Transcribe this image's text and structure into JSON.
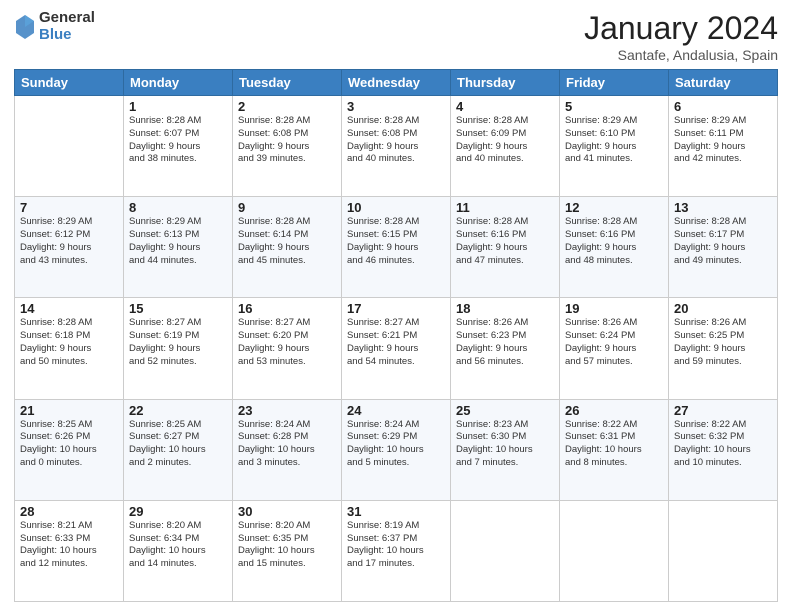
{
  "header": {
    "logo_general": "General",
    "logo_blue": "Blue",
    "month_title": "January 2024",
    "location": "Santafe, Andalusia, Spain"
  },
  "calendar": {
    "days_of_week": [
      "Sunday",
      "Monday",
      "Tuesday",
      "Wednesday",
      "Thursday",
      "Friday",
      "Saturday"
    ],
    "weeks": [
      [
        {
          "day": "",
          "info": ""
        },
        {
          "day": "1",
          "info": "Sunrise: 8:28 AM\nSunset: 6:07 PM\nDaylight: 9 hours\nand 38 minutes."
        },
        {
          "day": "2",
          "info": "Sunrise: 8:28 AM\nSunset: 6:08 PM\nDaylight: 9 hours\nand 39 minutes."
        },
        {
          "day": "3",
          "info": "Sunrise: 8:28 AM\nSunset: 6:08 PM\nDaylight: 9 hours\nand 40 minutes."
        },
        {
          "day": "4",
          "info": "Sunrise: 8:28 AM\nSunset: 6:09 PM\nDaylight: 9 hours\nand 40 minutes."
        },
        {
          "day": "5",
          "info": "Sunrise: 8:29 AM\nSunset: 6:10 PM\nDaylight: 9 hours\nand 41 minutes."
        },
        {
          "day": "6",
          "info": "Sunrise: 8:29 AM\nSunset: 6:11 PM\nDaylight: 9 hours\nand 42 minutes."
        }
      ],
      [
        {
          "day": "7",
          "info": "Sunrise: 8:29 AM\nSunset: 6:12 PM\nDaylight: 9 hours\nand 43 minutes."
        },
        {
          "day": "8",
          "info": "Sunrise: 8:29 AM\nSunset: 6:13 PM\nDaylight: 9 hours\nand 44 minutes."
        },
        {
          "day": "9",
          "info": "Sunrise: 8:28 AM\nSunset: 6:14 PM\nDaylight: 9 hours\nand 45 minutes."
        },
        {
          "day": "10",
          "info": "Sunrise: 8:28 AM\nSunset: 6:15 PM\nDaylight: 9 hours\nand 46 minutes."
        },
        {
          "day": "11",
          "info": "Sunrise: 8:28 AM\nSunset: 6:16 PM\nDaylight: 9 hours\nand 47 minutes."
        },
        {
          "day": "12",
          "info": "Sunrise: 8:28 AM\nSunset: 6:16 PM\nDaylight: 9 hours\nand 48 minutes."
        },
        {
          "day": "13",
          "info": "Sunrise: 8:28 AM\nSunset: 6:17 PM\nDaylight: 9 hours\nand 49 minutes."
        }
      ],
      [
        {
          "day": "14",
          "info": "Sunrise: 8:28 AM\nSunset: 6:18 PM\nDaylight: 9 hours\nand 50 minutes."
        },
        {
          "day": "15",
          "info": "Sunrise: 8:27 AM\nSunset: 6:19 PM\nDaylight: 9 hours\nand 52 minutes."
        },
        {
          "day": "16",
          "info": "Sunrise: 8:27 AM\nSunset: 6:20 PM\nDaylight: 9 hours\nand 53 minutes."
        },
        {
          "day": "17",
          "info": "Sunrise: 8:27 AM\nSunset: 6:21 PM\nDaylight: 9 hours\nand 54 minutes."
        },
        {
          "day": "18",
          "info": "Sunrise: 8:26 AM\nSunset: 6:23 PM\nDaylight: 9 hours\nand 56 minutes."
        },
        {
          "day": "19",
          "info": "Sunrise: 8:26 AM\nSunset: 6:24 PM\nDaylight: 9 hours\nand 57 minutes."
        },
        {
          "day": "20",
          "info": "Sunrise: 8:26 AM\nSunset: 6:25 PM\nDaylight: 9 hours\nand 59 minutes."
        }
      ],
      [
        {
          "day": "21",
          "info": "Sunrise: 8:25 AM\nSunset: 6:26 PM\nDaylight: 10 hours\nand 0 minutes."
        },
        {
          "day": "22",
          "info": "Sunrise: 8:25 AM\nSunset: 6:27 PM\nDaylight: 10 hours\nand 2 minutes."
        },
        {
          "day": "23",
          "info": "Sunrise: 8:24 AM\nSunset: 6:28 PM\nDaylight: 10 hours\nand 3 minutes."
        },
        {
          "day": "24",
          "info": "Sunrise: 8:24 AM\nSunset: 6:29 PM\nDaylight: 10 hours\nand 5 minutes."
        },
        {
          "day": "25",
          "info": "Sunrise: 8:23 AM\nSunset: 6:30 PM\nDaylight: 10 hours\nand 7 minutes."
        },
        {
          "day": "26",
          "info": "Sunrise: 8:22 AM\nSunset: 6:31 PM\nDaylight: 10 hours\nand 8 minutes."
        },
        {
          "day": "27",
          "info": "Sunrise: 8:22 AM\nSunset: 6:32 PM\nDaylight: 10 hours\nand 10 minutes."
        }
      ],
      [
        {
          "day": "28",
          "info": "Sunrise: 8:21 AM\nSunset: 6:33 PM\nDaylight: 10 hours\nand 12 minutes."
        },
        {
          "day": "29",
          "info": "Sunrise: 8:20 AM\nSunset: 6:34 PM\nDaylight: 10 hours\nand 14 minutes."
        },
        {
          "day": "30",
          "info": "Sunrise: 8:20 AM\nSunset: 6:35 PM\nDaylight: 10 hours\nand 15 minutes."
        },
        {
          "day": "31",
          "info": "Sunrise: 8:19 AM\nSunset: 6:37 PM\nDaylight: 10 hours\nand 17 minutes."
        },
        {
          "day": "",
          "info": ""
        },
        {
          "day": "",
          "info": ""
        },
        {
          "day": "",
          "info": ""
        }
      ]
    ]
  }
}
